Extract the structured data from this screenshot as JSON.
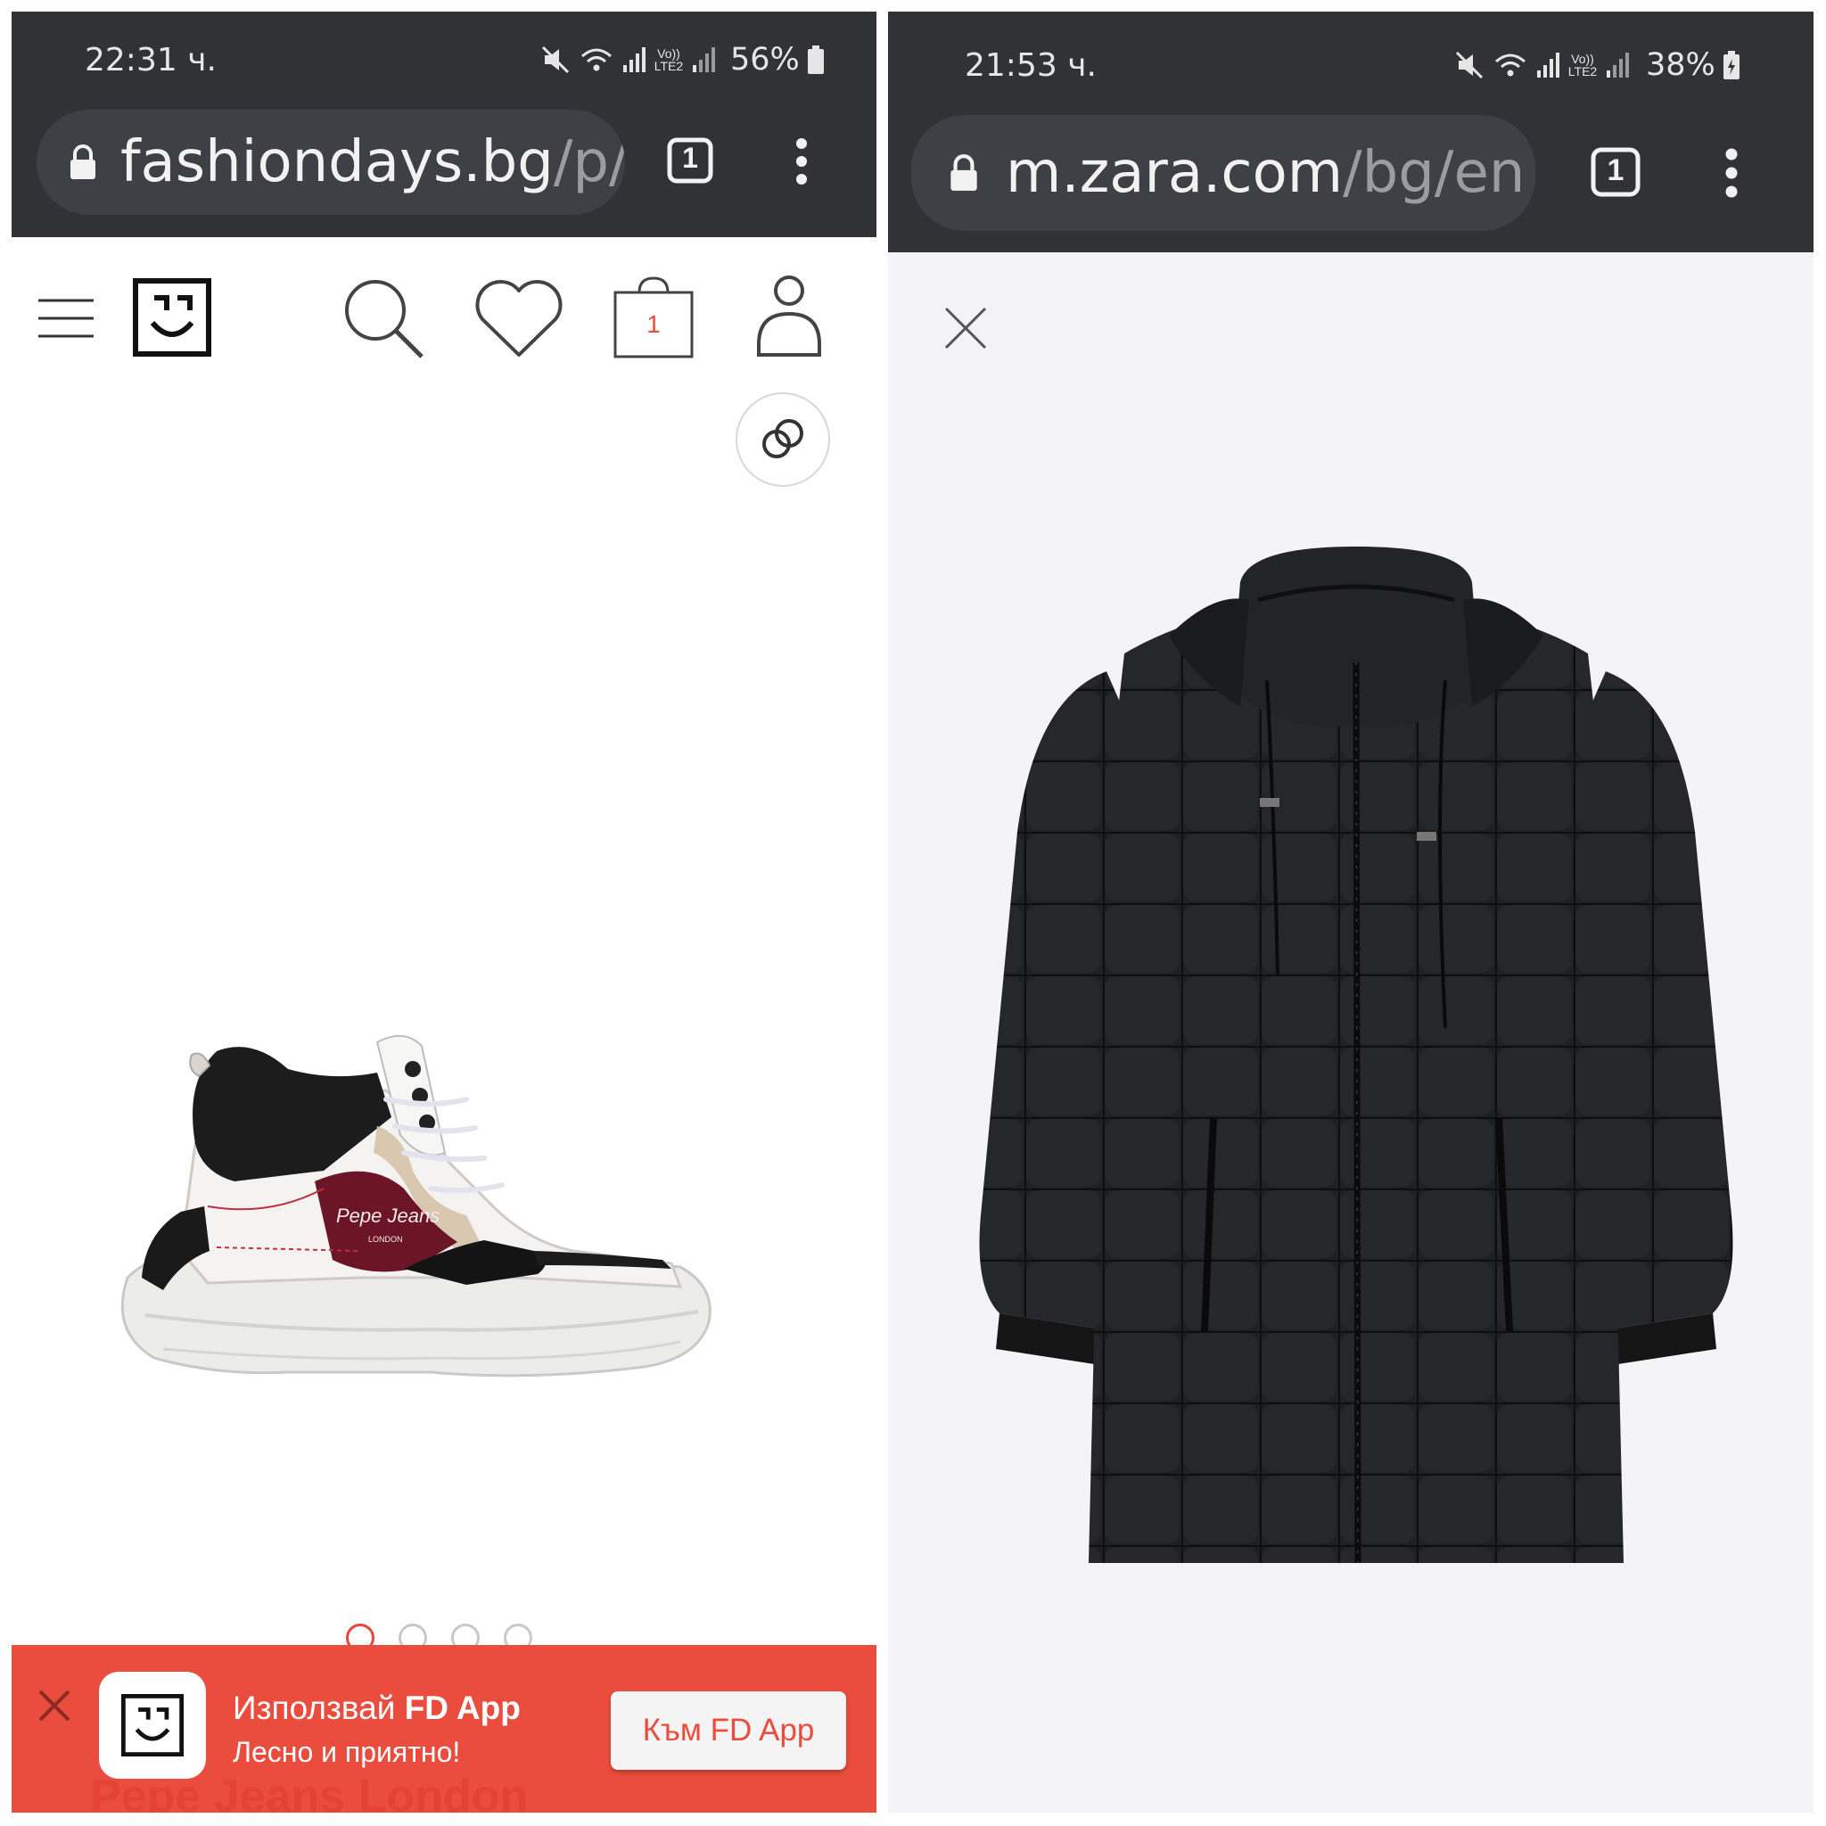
{
  "left_phone": {
    "status_bar": {
      "time": "22:31 ч.",
      "battery": "56%",
      "network_label": "Vo)) LTE2"
    },
    "browser": {
      "url_domain": "fashiondays.bg",
      "url_path": "/p/(",
      "tab_count": "1"
    },
    "header": {
      "bag_count": "1"
    },
    "gallery": {
      "total_images": 4,
      "active_index": 0
    },
    "promo_banner": {
      "text_prefix": "Използвай",
      "text_app": "FD App",
      "subtitle": "Лесно и приятно!",
      "button_label": "Към FD App",
      "underlying_text": "Pepe Jeans London"
    },
    "product": {
      "logo_script": "Pepe Jeans",
      "logo_sub": "LONDON"
    }
  },
  "right_phone": {
    "status_bar": {
      "time": "21:53 ч.",
      "battery": "38%",
      "network_label": "Vo)) LTE2"
    },
    "browser": {
      "url_domain": "m.zara.com",
      "url_path": "/bg/en",
      "tab_count": "1"
    }
  },
  "colors": {
    "chrome_bg": "#303236",
    "url_pill_bg": "#3e4045",
    "fd_accent": "#ea4d3d",
    "zara_bg": "#f4f4f6",
    "jacket": "#1e1f21"
  },
  "icons": [
    "lock-icon",
    "tabs-icon",
    "menu-dots-icon",
    "hamburger-icon",
    "fd-logo-icon",
    "search-icon",
    "heart-icon",
    "bag-icon",
    "user-icon",
    "share-icon",
    "close-icon",
    "mute-icon",
    "wifi-icon",
    "signal-icon",
    "battery-icon"
  ]
}
